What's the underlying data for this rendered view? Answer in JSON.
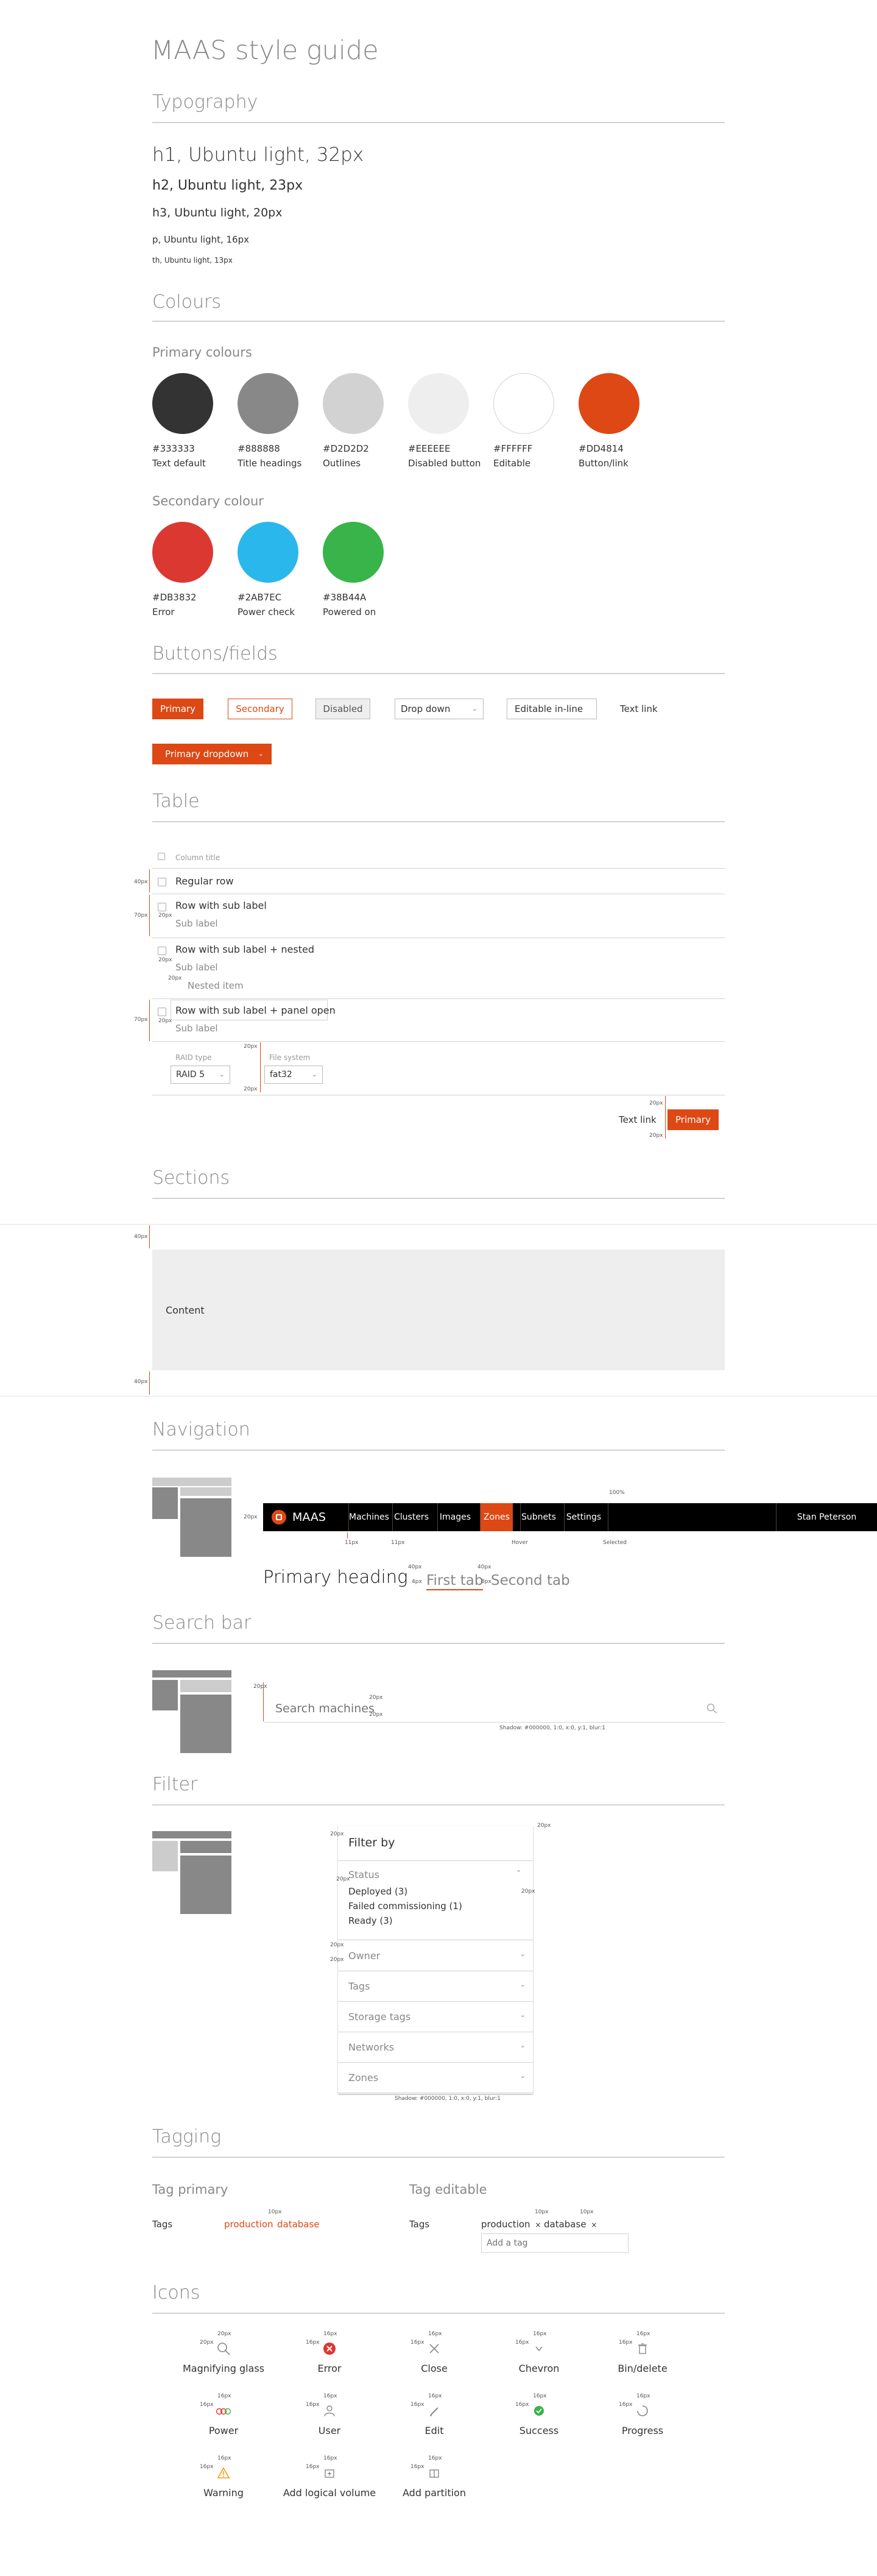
{
  "title": "MAAS style guide",
  "typography": {
    "heading": "Typography",
    "h1": "h1, Ubuntu light, 32px",
    "h2": "h2, Ubuntu light, 23px",
    "h3": "h3, Ubuntu light, 20px",
    "p": "p, Ubuntu light, 16px",
    "th": "th, Ubuntu light, 13px"
  },
  "colours": {
    "heading": "Colours",
    "primary_heading": "Primary colours",
    "primary": [
      {
        "hex": "#333333",
        "name": "Text default",
        "color": "#333333"
      },
      {
        "hex": "#888888",
        "name": "Title headings",
        "color": "#888888"
      },
      {
        "hex": "#D2D2D2",
        "name": "Outlines",
        "color": "#D2D2D2"
      },
      {
        "hex": "#EEEEEE",
        "name": "Disabled button",
        "color": "#EEEEEE"
      },
      {
        "hex": "#FFFFFF",
        "name": "Editable",
        "color": "#FFFFFF"
      },
      {
        "hex": "#DD4814",
        "name": "Button/link",
        "color": "#DD4814"
      }
    ],
    "secondary_heading": "Secondary colour",
    "secondary": [
      {
        "hex": "#DB3832",
        "name": "Error",
        "color": "#DB3832"
      },
      {
        "hex": "#2AB7EC",
        "name": "Power check",
        "color": "#2AB7EC"
      },
      {
        "hex": "#38B44A",
        "name": "Powered on",
        "color": "#38B44A"
      }
    ]
  },
  "buttons": {
    "heading": "Buttons/fields",
    "primary": "Primary",
    "secondary": "Secondary",
    "disabled": "Disabled",
    "dropdown": "Drop down",
    "editable": "Editable in-line",
    "text_link": "Text link",
    "primary_dropdown": "Primary dropdown"
  },
  "table": {
    "heading": "Table",
    "column_title": "Column title",
    "row1": "Regular row",
    "row2": "Row with sub label",
    "row2_sub": "Sub label",
    "row3": "Row with sub label + nested",
    "row3_sub": "Sub label",
    "row3_nested": "Nested item",
    "row4": "Row with sub label + panel open",
    "row4_sub": "Sub label",
    "raid_label": "RAID type",
    "raid_value": "RAID 5",
    "fs_label": "File system",
    "fs_value": "fat32",
    "text_link": "Text link",
    "primary": "Primary",
    "dims": {
      "d40": "40px",
      "d70": "70px",
      "d20": "20px"
    }
  },
  "sections": {
    "heading": "Sections",
    "content": "Content",
    "d40": "40px"
  },
  "navigation": {
    "heading": "Navigation",
    "brand": "MAAS",
    "items": [
      "Machines",
      "Clusters",
      "Images",
      "Zones",
      "Subnets",
      "Settings"
    ],
    "active_item": "Zones",
    "user": "Stan Peterson",
    "primary_heading": "Primary heading",
    "tab1": "First tab",
    "tab2": "Second tab",
    "pct": "100%",
    "d20": "20px",
    "d11": "11px",
    "hover": "Hover",
    "selected": "Selected",
    "d40": "40px",
    "d4": "4px",
    "d8": "8px"
  },
  "search": {
    "heading": "Search bar",
    "placeholder": "Search machines",
    "shadow": "Shadow: #000000, 1:0, x:0, y:1, blur:1",
    "d20": "20px"
  },
  "filter": {
    "heading": "Filter",
    "title": "Filter by",
    "status": "Status",
    "status_items": [
      "Deployed (3)",
      "Failed commissioning (1)",
      "Ready (3)"
    ],
    "groups": [
      "Owner",
      "Tags",
      "Storage tags",
      "Networks",
      "Zones"
    ],
    "shadow": "Shadow: #000000, 1:0, x:0, y:1, blur:1",
    "d20": "20px"
  },
  "tagging": {
    "heading": "Tagging",
    "primary_heading": "Tag primary",
    "editable_heading": "Tag editable",
    "tags_label": "Tags",
    "tag1": "production",
    "tag2": "database",
    "add_tag": "Add a tag",
    "d10": "10px"
  },
  "icons": {
    "heading": "Icons",
    "items": [
      {
        "label": "Magnifying glass",
        "icon": "magnifying-glass-icon"
      },
      {
        "label": "Error",
        "icon": "error-icon"
      },
      {
        "label": "Close",
        "icon": "close-icon"
      },
      {
        "label": "Chevron",
        "icon": "chevron-icon"
      },
      {
        "label": "Bin/delete",
        "icon": "bin-icon"
      },
      {
        "label": "Power",
        "icon": "power-icon"
      },
      {
        "label": "User",
        "icon": "user-icon"
      },
      {
        "label": "Edit",
        "icon": "edit-icon"
      },
      {
        "label": "Success",
        "icon": "success-icon"
      },
      {
        "label": "Progress",
        "icon": "progress-icon"
      },
      {
        "label": "Warning",
        "icon": "warning-icon"
      },
      {
        "label": "Add logical volume",
        "icon": "add-logical-volume-icon"
      },
      {
        "label": "Add partition",
        "icon": "add-partition-icon"
      }
    ],
    "d20": "20px",
    "d16": "16px"
  }
}
